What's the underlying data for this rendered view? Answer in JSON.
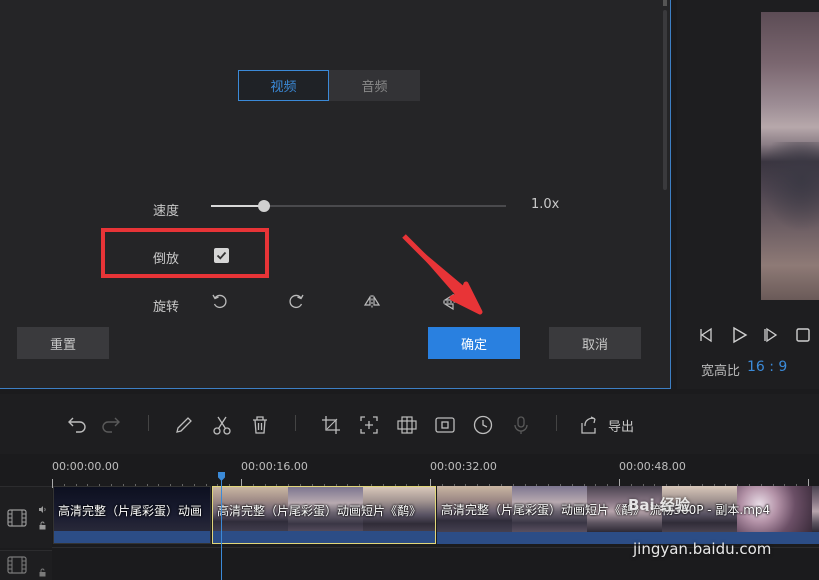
{
  "edit_panel": {
    "tabs": [
      {
        "label": "视频",
        "active": true
      },
      {
        "label": "音频",
        "active": false
      }
    ],
    "speed": {
      "label": "速度",
      "value_text": "1.0x",
      "slider_fraction": 0.18
    },
    "reverse": {
      "label": "倒放",
      "checked": true
    },
    "rotate": {
      "label": "旋转",
      "icons": [
        "rotate-left-icon",
        "rotate-right-icon",
        "flip-horizontal-icon",
        "flip-vertical-icon"
      ]
    },
    "buttons": {
      "reset": "重置",
      "confirm": "确定",
      "cancel": "取消"
    },
    "annotation_color": "#e83437",
    "accent_color": "#2980e0"
  },
  "preview": {
    "ratio_label": "宽高比",
    "ratio_value": "16 : 9",
    "controls": [
      "previous-frame-icon",
      "play-icon",
      "next-frame-icon",
      "stop-icon"
    ]
  },
  "toolbar": {
    "icons": [
      "undo-icon",
      "redo-icon",
      "pencil-icon",
      "scissors-icon",
      "trash-icon",
      "crop-icon",
      "zoom-icon",
      "mosaic-icon",
      "freeze-frame-icon",
      "duration-icon",
      "microphone-icon",
      "export-icon"
    ],
    "export_label": "导出"
  },
  "timeline": {
    "timecodes": [
      "00:00:00.00",
      "00:00:16.00",
      "00:00:32.00",
      "00:00:48.00"
    ],
    "clips": [
      {
        "title": "高清完整（片尾彩蛋）动画"
      },
      {
        "title": "高清完整（片尾彩蛋）动画短片《鹬》"
      },
      {
        "title": "高清完整（片尾彩蛋）动画短片《鹬》-流畅360P - 副本.mp4"
      }
    ]
  },
  "watermark": {
    "brand": "Bai 经验",
    "url": "jingyan.baidu.com"
  }
}
